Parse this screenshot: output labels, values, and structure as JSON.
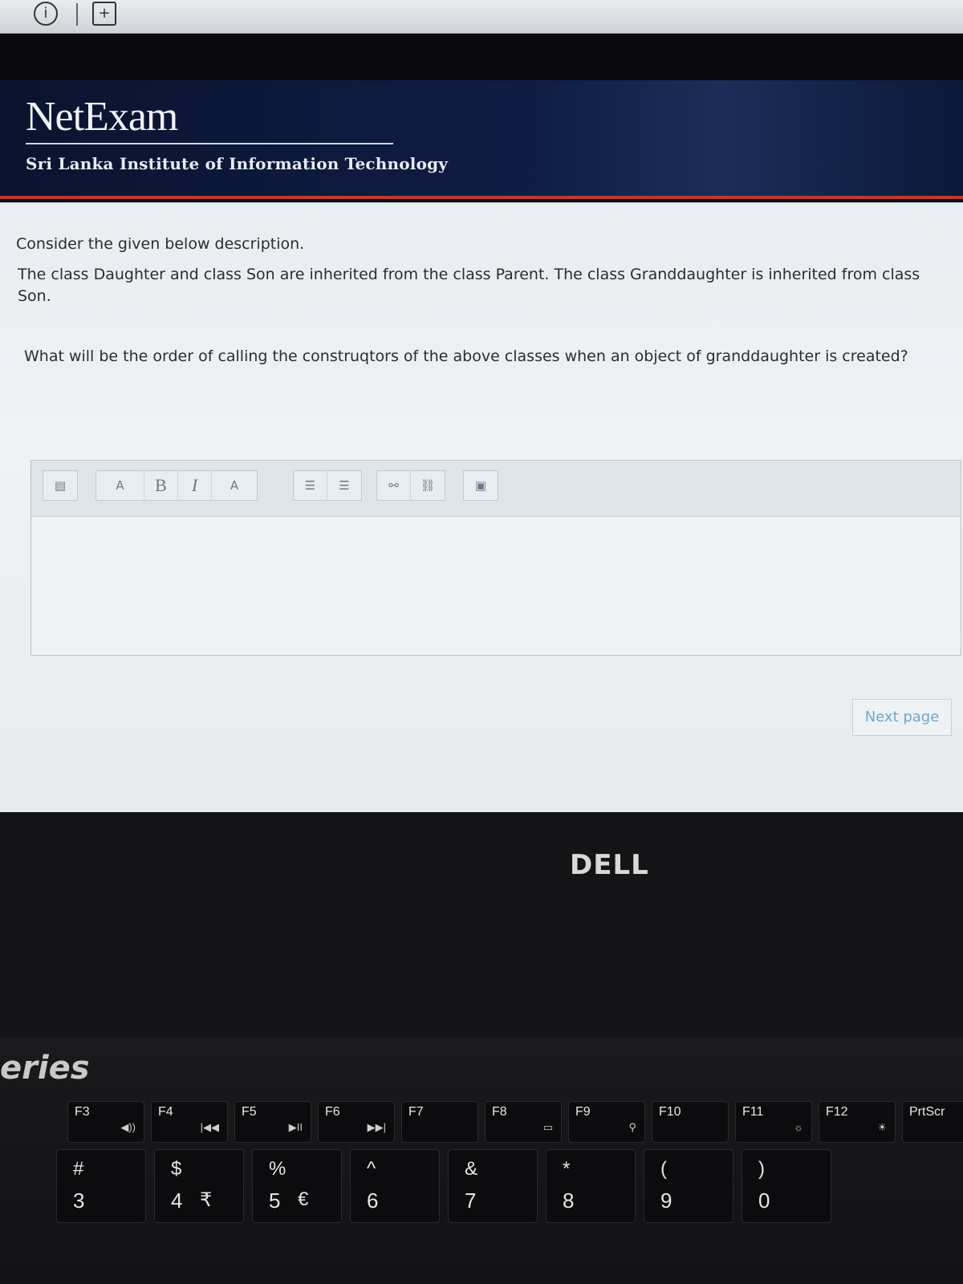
{
  "browser": {
    "info_icon": "info-circle-icon",
    "tab_icon": "plus-box-icon"
  },
  "header": {
    "logo": "NetExam",
    "institute": "Sri Lanka Institute of Information Technology",
    "accent_color": "#c0392b"
  },
  "question": {
    "intro": "Consider the given below description.",
    "description": "The class Daughter and class Son are inherited from the class Parent. The class Granddaughter is inherited from class Son.",
    "prompt": "What will be the order of calling the construqtors of the above classes when an object of granddaughter is created?"
  },
  "editor": {
    "toolbar": {
      "show_more": "▤",
      "paragraph": "A",
      "bold": "B",
      "italic": "I",
      "font_color": "A",
      "unordered_list": "☰",
      "ordered_list": "☰",
      "link": "⚯",
      "unlink": "⛓",
      "image": "▣"
    }
  },
  "next_button": {
    "label": "Next page"
  },
  "laptop": {
    "brand": "DELL",
    "series": "eries",
    "fkeys": [
      {
        "label": "F3",
        "sym": "◀))"
      },
      {
        "label": "F4",
        "sym": "|◀◀"
      },
      {
        "label": "F5",
        "sym": "▶II"
      },
      {
        "label": "F6",
        "sym": "▶▶|"
      },
      {
        "label": "F7",
        "sym": ""
      },
      {
        "label": "F8",
        "sym": "▭"
      },
      {
        "label": "F9",
        "sym": "⚲"
      },
      {
        "label": "F10",
        "sym": ""
      },
      {
        "label": "F11",
        "sym": "☼"
      },
      {
        "label": "F12",
        "sym": "☀"
      },
      {
        "label": "PrtScr",
        "sym": ""
      }
    ],
    "numkeys": [
      {
        "up": "#",
        "dn": "3",
        "ex": ""
      },
      {
        "up": "$",
        "dn": "4",
        "ex": "₹"
      },
      {
        "up": "%",
        "dn": "5",
        "ex": "€"
      },
      {
        "up": "^",
        "dn": "6",
        "ex": ""
      },
      {
        "up": "&",
        "dn": "7",
        "ex": ""
      },
      {
        "up": "*",
        "dn": "8",
        "ex": ""
      },
      {
        "up": "(",
        "dn": "9",
        "ex": ""
      },
      {
        "up": ")",
        "dn": "0",
        "ex": ""
      }
    ]
  }
}
